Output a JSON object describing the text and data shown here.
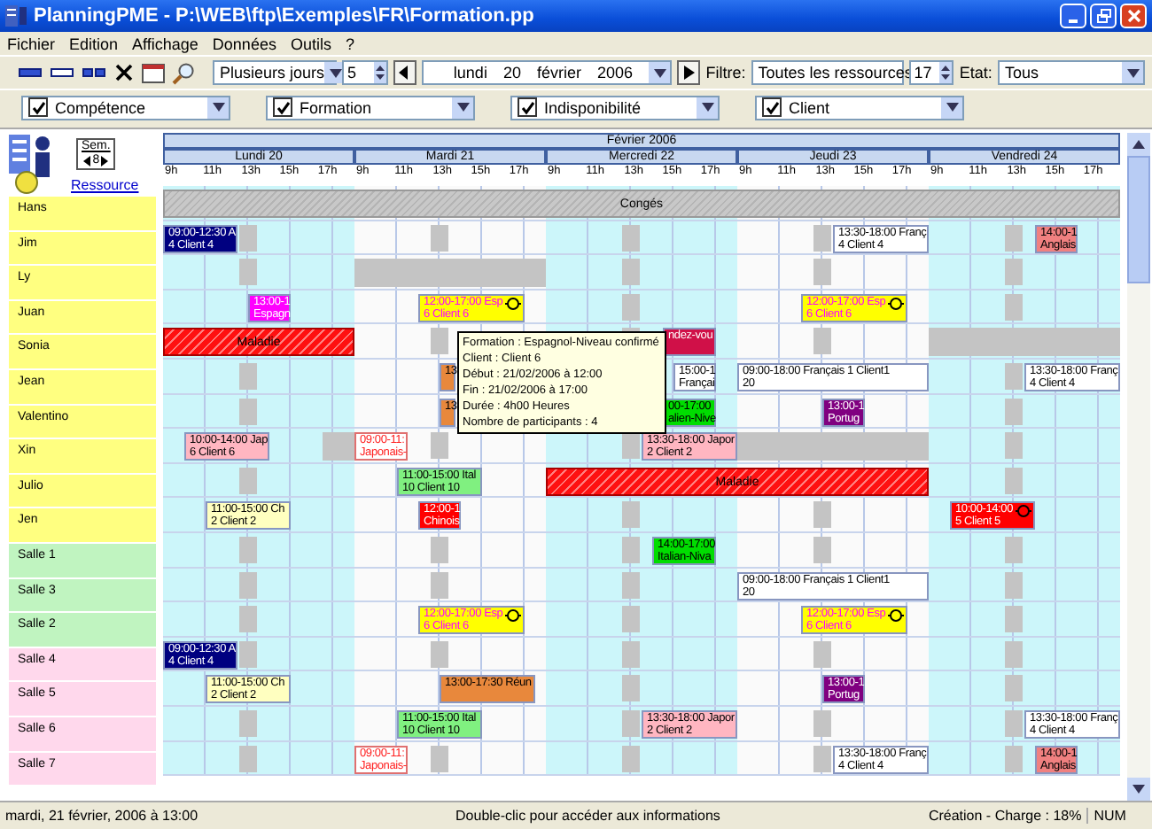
{
  "window": {
    "title": "PlanningPME - P:\\WEB\\ftp\\Exemples\\FR\\Formation.pp"
  },
  "menu": [
    "Fichier",
    "Edition",
    "Affichage",
    "Données",
    "Outils",
    "?"
  ],
  "toolbar": {
    "view_mode": "Plusieurs jours",
    "day_count": "5",
    "date": [
      "lundi",
      "20",
      "février",
      "2006"
    ],
    "filter_label": "Filtre:",
    "filter": "Toutes les ressources",
    "resource_count": "17",
    "state_label": "Etat:",
    "state": "Tous"
  },
  "filters": [
    {
      "label": "Compétence",
      "checked": true
    },
    {
      "label": "Formation",
      "checked": true
    },
    {
      "label": "Indisponibilité",
      "checked": true
    },
    {
      "label": "Client",
      "checked": true
    }
  ],
  "navigator": {
    "week_label": "Sem.",
    "week": "8",
    "resource_link": "Ressource"
  },
  "calendar": {
    "month": "Février 2006",
    "days": [
      {
        "label": "Lundi 20",
        "hours": [
          "9h",
          "11h",
          "13h",
          "15h",
          "17h"
        ]
      },
      {
        "label": "Mardi 21",
        "hours": [
          "9h",
          "11h",
          "13h",
          "15h",
          "17h"
        ]
      },
      {
        "label": "Mercredi 22",
        "hours": [
          "9h",
          "11h",
          "13h",
          "15h",
          "17h"
        ]
      },
      {
        "label": "Jeudi 23",
        "hours": [
          "9h",
          "11h",
          "13h",
          "15h",
          "17h"
        ]
      },
      {
        "label": "Vendredi 24",
        "hours": [
          "9h",
          "11h",
          "13h",
          "15h",
          "17h"
        ]
      }
    ],
    "resources": [
      {
        "name": "Hans",
        "color": "#ffff80",
        "bookings": [
          {
            "kind": "conge",
            "lines": [
              "Congés"
            ]
          }
        ]
      },
      {
        "name": "Jim",
        "color": "#ffff80",
        "bookings": [
          {
            "kind": "event",
            "color": "#000080",
            "lines": [
              "09:00-12:30 A",
              "4 Client 4"
            ]
          },
          {
            "kind": "event",
            "color": "#ffffff",
            "lines": [
              "13:30-18:00 Franç",
              "4 Client 4"
            ]
          },
          {
            "kind": "event",
            "color": "#f08080",
            "lines": [
              "14:00-1",
              "Anglais"
            ]
          }
        ]
      },
      {
        "name": "Ly",
        "color": "#ffff80",
        "bookings": [
          {
            "kind": "indispo"
          }
        ]
      },
      {
        "name": "Juan",
        "color": "#ffff80",
        "bookings": [
          {
            "kind": "event",
            "color": "#ff00ff",
            "lines": [
              "13:00-1",
              "Espagn"
            ]
          },
          {
            "kind": "highlight",
            "color": "#ffff00",
            "icon": true,
            "lines": [
              "12:00-17:00 Esp",
              "6 Client 6"
            ]
          },
          {
            "kind": "highlight",
            "color": "#ffff00",
            "icon": true,
            "lines": [
              "12:00-17:00 Esp",
              "6 Client 6"
            ]
          }
        ]
      },
      {
        "name": "Sonia",
        "color": "#ffff80",
        "bookings": [
          {
            "kind": "maladie",
            "lines": [
              "Maladie"
            ]
          },
          {
            "kind": "event",
            "color": "#d01048",
            "lines": [
              "ndez-vou"
            ]
          },
          {
            "kind": "indispo"
          }
        ]
      },
      {
        "name": "Jean",
        "color": "#ffff80",
        "bookings": [
          {
            "kind": "event",
            "color": "#e8883c",
            "lines": [
              "13"
            ]
          },
          {
            "kind": "event",
            "color": "#ffffff",
            "lines": [
              "15:00-1",
              "Françai"
            ]
          },
          {
            "kind": "event",
            "color": "#ffffff",
            "lines": [
              "09:00-18:00 Français 1 Client1",
              "20"
            ]
          },
          {
            "kind": "event",
            "color": "#ffffff",
            "lines": [
              "13:30-18:00 Franç",
              "4 Client 4"
            ]
          }
        ]
      },
      {
        "name": "Valentino",
        "color": "#ffff80",
        "bookings": [
          {
            "kind": "event",
            "color": "#e8883c",
            "lines": [
              "13"
            ]
          },
          {
            "kind": "event",
            "color": "#00dd00",
            "lines": [
              "00-17:00",
              "alien-Nive"
            ]
          },
          {
            "kind": "event",
            "color": "#800080",
            "lines": [
              "13:00-1",
              "Portug"
            ]
          }
        ]
      },
      {
        "name": "Xin",
        "color": "#ffff80",
        "bookings": [
          {
            "kind": "event",
            "color": "#ffb6c1",
            "lines": [
              "10:00-14:00 Jap",
              "6 Client 6"
            ]
          },
          {
            "kind": "indispo"
          },
          {
            "kind": "outline",
            "color": "#ffffff",
            "lines": [
              "09:00-11:",
              "Japonais-"
            ]
          },
          {
            "kind": "event",
            "color": "#ffb6c1",
            "lines": [
              "13:30-18:00 Japor",
              "2 Client 2"
            ]
          },
          {
            "kind": "indispo"
          }
        ]
      },
      {
        "name": "Julio",
        "color": "#ffff80",
        "bookings": [
          {
            "kind": "event",
            "color": "#80f080",
            "lines": [
              "11:00-15:00 Ital",
              "10 Client 10"
            ]
          },
          {
            "kind": "maladie",
            "lines": [
              "Maladie"
            ]
          }
        ]
      },
      {
        "name": "Jen",
        "color": "#ffff80",
        "bookings": [
          {
            "kind": "event",
            "color": "#ffffc0",
            "lines": [
              "11:00-15:00 Ch",
              "2 Client 2"
            ]
          },
          {
            "kind": "event",
            "color": "#ff0000",
            "lines": [
              "12:00-1",
              "Chinois"
            ]
          },
          {
            "kind": "event",
            "color": "#ff0000",
            "icon": true,
            "lines": [
              "10:00-14:00",
              "5 Client 5"
            ]
          }
        ]
      },
      {
        "name": "Salle 1",
        "color": "#c0f4c0",
        "bookings": [
          {
            "kind": "event",
            "color": "#00dd00",
            "lines": [
              "14:00-17:00",
              "Italian-Niva"
            ]
          }
        ]
      },
      {
        "name": "Salle 3",
        "color": "#c0f4c0",
        "bookings": [
          {
            "kind": "event",
            "color": "#ffffff",
            "lines": [
              "09:00-18:00 Français 1 Client1",
              "20"
            ]
          }
        ]
      },
      {
        "name": "Salle 2",
        "color": "#c0f4c0",
        "bookings": [
          {
            "kind": "highlight",
            "color": "#ffff00",
            "icon": true,
            "lines": [
              "12:00-17:00 Esp",
              "6 Client 6"
            ]
          },
          {
            "kind": "highlight",
            "color": "#ffff00",
            "icon": true,
            "lines": [
              "12:00-17:00 Esp",
              "6 Client 6"
            ]
          }
        ]
      },
      {
        "name": "Salle 4",
        "color": "#ffd8ec",
        "bookings": [
          {
            "kind": "event",
            "color": "#000080",
            "lines": [
              "09:00-12:30 A",
              "4 Client 4"
            ]
          }
        ]
      },
      {
        "name": "Salle 5",
        "color": "#ffd8ec",
        "bookings": [
          {
            "kind": "event",
            "color": "#ffffc0",
            "lines": [
              "11:00-15:00 Ch",
              "2 Client 2"
            ]
          },
          {
            "kind": "event",
            "color": "#e8883c",
            "lines": [
              "13:00-17:30 Réun"
            ]
          },
          {
            "kind": "event",
            "color": "#800080",
            "lines": [
              "13:00-1",
              "Portug"
            ]
          }
        ]
      },
      {
        "name": "Salle 6",
        "color": "#ffd8ec",
        "bookings": [
          {
            "kind": "event",
            "color": "#80f080",
            "lines": [
              "11:00-15:00 Ital",
              "10 Client 10"
            ]
          },
          {
            "kind": "event",
            "color": "#ffb6c1",
            "lines": [
              "13:30-18:00 Japor",
              "2 Client 2"
            ]
          },
          {
            "kind": "event",
            "color": "#ffffff",
            "lines": [
              "13:30-18:00 Franç",
              "4 Client 4"
            ]
          }
        ]
      },
      {
        "name": "Salle 7",
        "color": "#ffd8ec",
        "bookings": [
          {
            "kind": "outline",
            "color": "#ffffff",
            "lines": [
              "09:00-11:",
              "Japonais-"
            ]
          },
          {
            "kind": "event",
            "color": "#ffffff",
            "lines": [
              "13:30-18:00 Franç",
              "4 Client 4"
            ]
          },
          {
            "kind": "event",
            "color": "#f08080",
            "lines": [
              "14:00-1",
              "Anglais"
            ]
          }
        ]
      }
    ],
    "tooltip": [
      "Formation : Espagnol-Niveau confirmé",
      "Client : Client 6",
      "Début : 21/02/2006 à 12:00",
      "Fin : 21/02/2006 à 17:00",
      "Durée : 4h00 Heures",
      "Nombre de participants : 4"
    ]
  },
  "status_bar": [
    "mardi, 21 février, 2006 à 13:00",
    "Double-clic pour accéder aux informations",
    "Création - Charge : 18%",
    "NUM"
  ]
}
